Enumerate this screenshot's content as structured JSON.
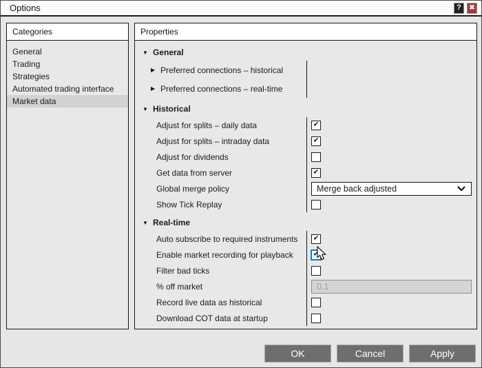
{
  "window": {
    "title": "Options",
    "help_glyph": "?",
    "close_glyph": "✖"
  },
  "icons": {
    "section_expanded": "▼",
    "row_collapsed": "▶",
    "check": "✔"
  },
  "categories": {
    "header": "Categories",
    "items": [
      {
        "label": "General",
        "selected": false
      },
      {
        "label": "Trading",
        "selected": false
      },
      {
        "label": "Strategies",
        "selected": false
      },
      {
        "label": "Automated trading interface",
        "selected": false
      },
      {
        "label": "Market data",
        "selected": true
      }
    ]
  },
  "properties": {
    "header": "Properties",
    "sections": [
      {
        "label": "General",
        "rows": [
          {
            "type": "expander",
            "label": "Preferred connections – historical"
          },
          {
            "type": "expander",
            "label": "Preferred connections – real-time"
          }
        ]
      },
      {
        "label": "Historical",
        "rows": [
          {
            "type": "checkbox",
            "label": "Adjust for splits – daily data",
            "checked": true,
            "focused": false
          },
          {
            "type": "checkbox",
            "label": "Adjust for splits – intraday data",
            "checked": true,
            "focused": false
          },
          {
            "type": "checkbox",
            "label": "Adjust for dividends",
            "checked": false,
            "focused": false
          },
          {
            "type": "checkbox",
            "label": "Get data from server",
            "checked": true,
            "focused": false
          },
          {
            "type": "select",
            "label": "Global merge policy",
            "value": "Merge back adjusted"
          },
          {
            "type": "checkbox",
            "label": "Show Tick Replay",
            "checked": false,
            "focused": false
          }
        ]
      },
      {
        "label": "Real-time",
        "rows": [
          {
            "type": "checkbox",
            "label": "Auto subscribe to required instruments",
            "checked": true,
            "focused": false
          },
          {
            "type": "checkbox",
            "label": "Enable market recording for playback",
            "checked": true,
            "focused": true
          },
          {
            "type": "checkbox",
            "label": "Filter bad ticks",
            "checked": false,
            "focused": false
          },
          {
            "type": "text",
            "label": "% off market",
            "value": "0.1",
            "disabled": true
          },
          {
            "type": "checkbox",
            "label": "Record live data as historical",
            "checked": false,
            "focused": false
          },
          {
            "type": "checkbox",
            "label": "Download COT data at startup",
            "checked": false,
            "focused": false
          }
        ]
      }
    ]
  },
  "footer": {
    "ok_label": "OK",
    "cancel_label": "Cancel",
    "apply_label": "Apply"
  }
}
